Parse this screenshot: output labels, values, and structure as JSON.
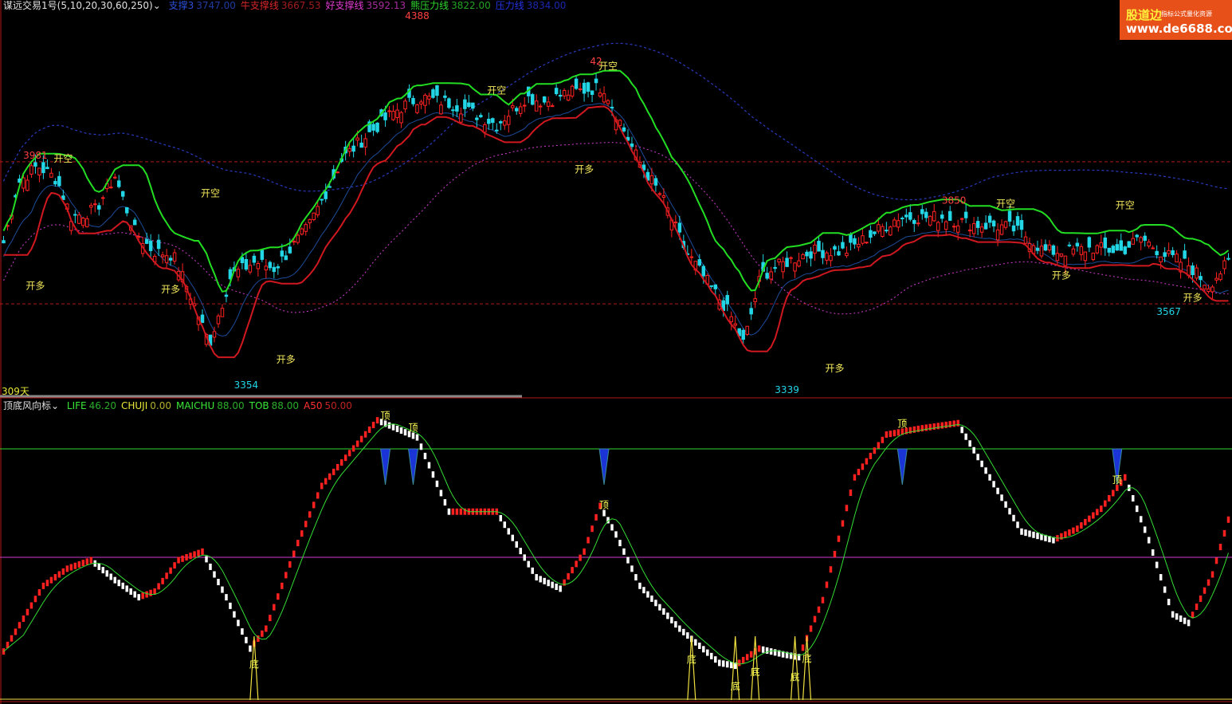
{
  "header": {
    "indicator_name": "谋远交易1号(5,10,20,30,60,250)",
    "items": [
      {
        "label": "支撑3",
        "value": "3747.00",
        "color": "#2b4fd6"
      },
      {
        "label": "牛支撑线",
        "value": "3667.53",
        "color": "#d8262a"
      },
      {
        "label": "好支撑线",
        "value": "3592.13",
        "color": "#e13bd0"
      },
      {
        "label": "熊压力线",
        "value": "3822.00",
        "color": "#2fd82f"
      },
      {
        "label": "压力线",
        "value": "3834.00",
        "color": "#2333e8"
      }
    ]
  },
  "sub_header": {
    "indicator_name": "顶底风向标",
    "items": [
      {
        "label": "LIFE",
        "value": "46.20",
        "color": "#39e639"
      },
      {
        "label": "CHUJI",
        "value": "0.00",
        "color": "#e8e83a"
      },
      {
        "label": "MAICHU",
        "value": "88.00",
        "color": "#39e639"
      },
      {
        "label": "TOB",
        "value": "88.00",
        "color": "#39e639"
      },
      {
        "label": "A50",
        "value": "50.00",
        "color": "#ff3030"
      }
    ]
  },
  "logo": {
    "line1": "股道边",
    "line2": "指标公式量化资源",
    "line3": "www.de6688.com"
  },
  "period_label": "309天",
  "colors": {
    "up": "#ff2222",
    "down": "#22d6e6",
    "green": "#22dd22",
    "red": "#d01820",
    "magenta": "#d03ad0",
    "blue": "#2a3ac0",
    "yellow": "#ffff55"
  },
  "chart_data": [
    {
      "type": "candlestick",
      "title": "",
      "ylim": [
        3300,
        4420
      ],
      "x_count": 309,
      "horizontal_levels": [
        3981,
        3567
      ],
      "price_anchors": [
        [
          0,
          3745
        ],
        [
          6,
          3920
        ],
        [
          14,
          3970
        ],
        [
          22,
          3930
        ],
        [
          28,
          3820
        ],
        [
          38,
          3840
        ],
        [
          46,
          3940
        ],
        [
          54,
          3780
        ],
        [
          62,
          3720
        ],
        [
          70,
          3710
        ],
        [
          78,
          3580
        ],
        [
          85,
          3450
        ],
        [
          94,
          3650
        ],
        [
          104,
          3690
        ],
        [
          112,
          3670
        ],
        [
          126,
          3790
        ],
        [
          140,
          3990
        ],
        [
          152,
          4070
        ],
        [
          162,
          4130
        ],
        [
          172,
          4170
        ],
        [
          186,
          4150
        ],
        [
          192,
          4130
        ],
        [
          204,
          4090
        ],
        [
          216,
          4170
        ],
        [
          224,
          4155
        ],
        [
          232,
          4180
        ],
        [
          248,
          4200
        ],
        [
          262,
          3990
        ],
        [
          272,
          3880
        ],
        [
          282,
          3720
        ],
        [
          290,
          3640
        ],
        [
          300,
          3540
        ],
        [
          306,
          3450
        ],
        [
          313,
          3650
        ],
        [
          324,
          3690
        ],
        [
          334,
          3720
        ],
        [
          348,
          3720
        ],
        [
          370,
          3820
        ],
        [
          388,
          3820
        ],
        [
          400,
          3800
        ],
        [
          416,
          3790
        ],
        [
          424,
          3760
        ],
        [
          430,
          3720
        ],
        [
          440,
          3720
        ],
        [
          450,
          3730
        ],
        [
          462,
          3720
        ],
        [
          470,
          3760
        ],
        [
          480,
          3710
        ],
        [
          490,
          3680
        ],
        [
          498,
          3620
        ],
        [
          508,
          3700
        ]
      ],
      "x_anchor_scale": 0.6083,
      "labels": [
        {
          "text": "4388",
          "i": 104,
          "v": 4388,
          "color": "#ff4040",
          "pos": "above"
        },
        {
          "text": "3981",
          "i": 8,
          "v": 3981,
          "color": "#ff4040",
          "pos": "above"
        },
        {
          "text": "3850",
          "i": 239,
          "v": 3850,
          "color": "#ff4040",
          "pos": "above"
        },
        {
          "text": "42",
          "i": 149,
          "v": 4255,
          "color": "#ff4040",
          "pos": "above"
        },
        {
          "text": "3354",
          "i": 61,
          "v": 3354,
          "color": "#22d6e6",
          "pos": "below"
        },
        {
          "text": "3339",
          "i": 197,
          "v": 3339,
          "color": "#22d6e6",
          "pos": "below"
        },
        {
          "text": "3567",
          "i": 293,
          "v": 3567,
          "color": "#22d6e6",
          "pos": "below"
        }
      ],
      "signals": [
        {
          "text": "开空",
          "i": 15,
          "v": 3981
        },
        {
          "text": "开空",
          "i": 52,
          "v": 3880
        },
        {
          "text": "开空",
          "i": 124,
          "v": 4180
        },
        {
          "text": "开空",
          "i": 152,
          "v": 4250
        },
        {
          "text": "开空",
          "i": 252,
          "v": 3850
        },
        {
          "text": "开空",
          "i": 282,
          "v": 3845
        },
        {
          "text": "开多",
          "i": 8,
          "v": 3610
        },
        {
          "text": "开多",
          "i": 42,
          "v": 3600
        },
        {
          "text": "开多",
          "i": 71,
          "v": 3395
        },
        {
          "text": "开多",
          "i": 146,
          "v": 3950
        },
        {
          "text": "开多",
          "i": 209,
          "v": 3370
        },
        {
          "text": "开多",
          "i": 266,
          "v": 3640
        },
        {
          "text": "开多",
          "i": 299,
          "v": 3575
        }
      ]
    },
    {
      "type": "bar",
      "title": "顶底风向标",
      "ylim": [
        0,
        100
      ],
      "reference_lines": [
        88,
        50
      ],
      "oscillator_anchors": [
        [
          0,
          17
        ],
        [
          10,
          40
        ],
        [
          16,
          46
        ],
        [
          22,
          49
        ],
        [
          28,
          42
        ],
        [
          34,
          36
        ],
        [
          38,
          38
        ],
        [
          44,
          49
        ],
        [
          50,
          52
        ],
        [
          56,
          36
        ],
        [
          62,
          18
        ],
        [
          66,
          25
        ],
        [
          74,
          55
        ],
        [
          80,
          75
        ],
        [
          94,
          98
        ],
        [
          104,
          92
        ],
        [
          112,
          66
        ],
        [
          124,
          66
        ],
        [
          134,
          43
        ],
        [
          140,
          39
        ],
        [
          146,
          52
        ],
        [
          150,
          68
        ],
        [
          154,
          58
        ],
        [
          160,
          40
        ],
        [
          170,
          25
        ],
        [
          180,
          13
        ],
        [
          184,
          12
        ],
        [
          190,
          18
        ],
        [
          196,
          16
        ],
        [
          200,
          15
        ],
        [
          206,
          35
        ],
        [
          214,
          78
        ],
        [
          222,
          93
        ],
        [
          230,
          95
        ],
        [
          240,
          97
        ],
        [
          248,
          78
        ],
        [
          256,
          59
        ],
        [
          264,
          56
        ],
        [
          270,
          60
        ],
        [
          276,
          67
        ],
        [
          282,
          78
        ],
        [
          288,
          56
        ],
        [
          294,
          30
        ],
        [
          298,
          27
        ],
        [
          304,
          44
        ],
        [
          309,
          68
        ]
      ],
      "x_anchor_scale": 1.0,
      "top_marks": [
        {
          "text": "顶",
          "i": 96
        },
        {
          "text": "顶",
          "i": 103
        },
        {
          "text": "顶",
          "i": 151
        },
        {
          "text": "顶",
          "i": 226
        },
        {
          "text": "顶",
          "i": 280
        }
      ],
      "bottom_marks": [
        {
          "text": "底",
          "i": 63
        },
        {
          "text": "底",
          "i": 173
        },
        {
          "text": "底",
          "i": 184
        },
        {
          "text": "底",
          "i": 189
        },
        {
          "text": "底",
          "i": 199
        },
        {
          "text": "底",
          "i": 202
        }
      ]
    }
  ]
}
